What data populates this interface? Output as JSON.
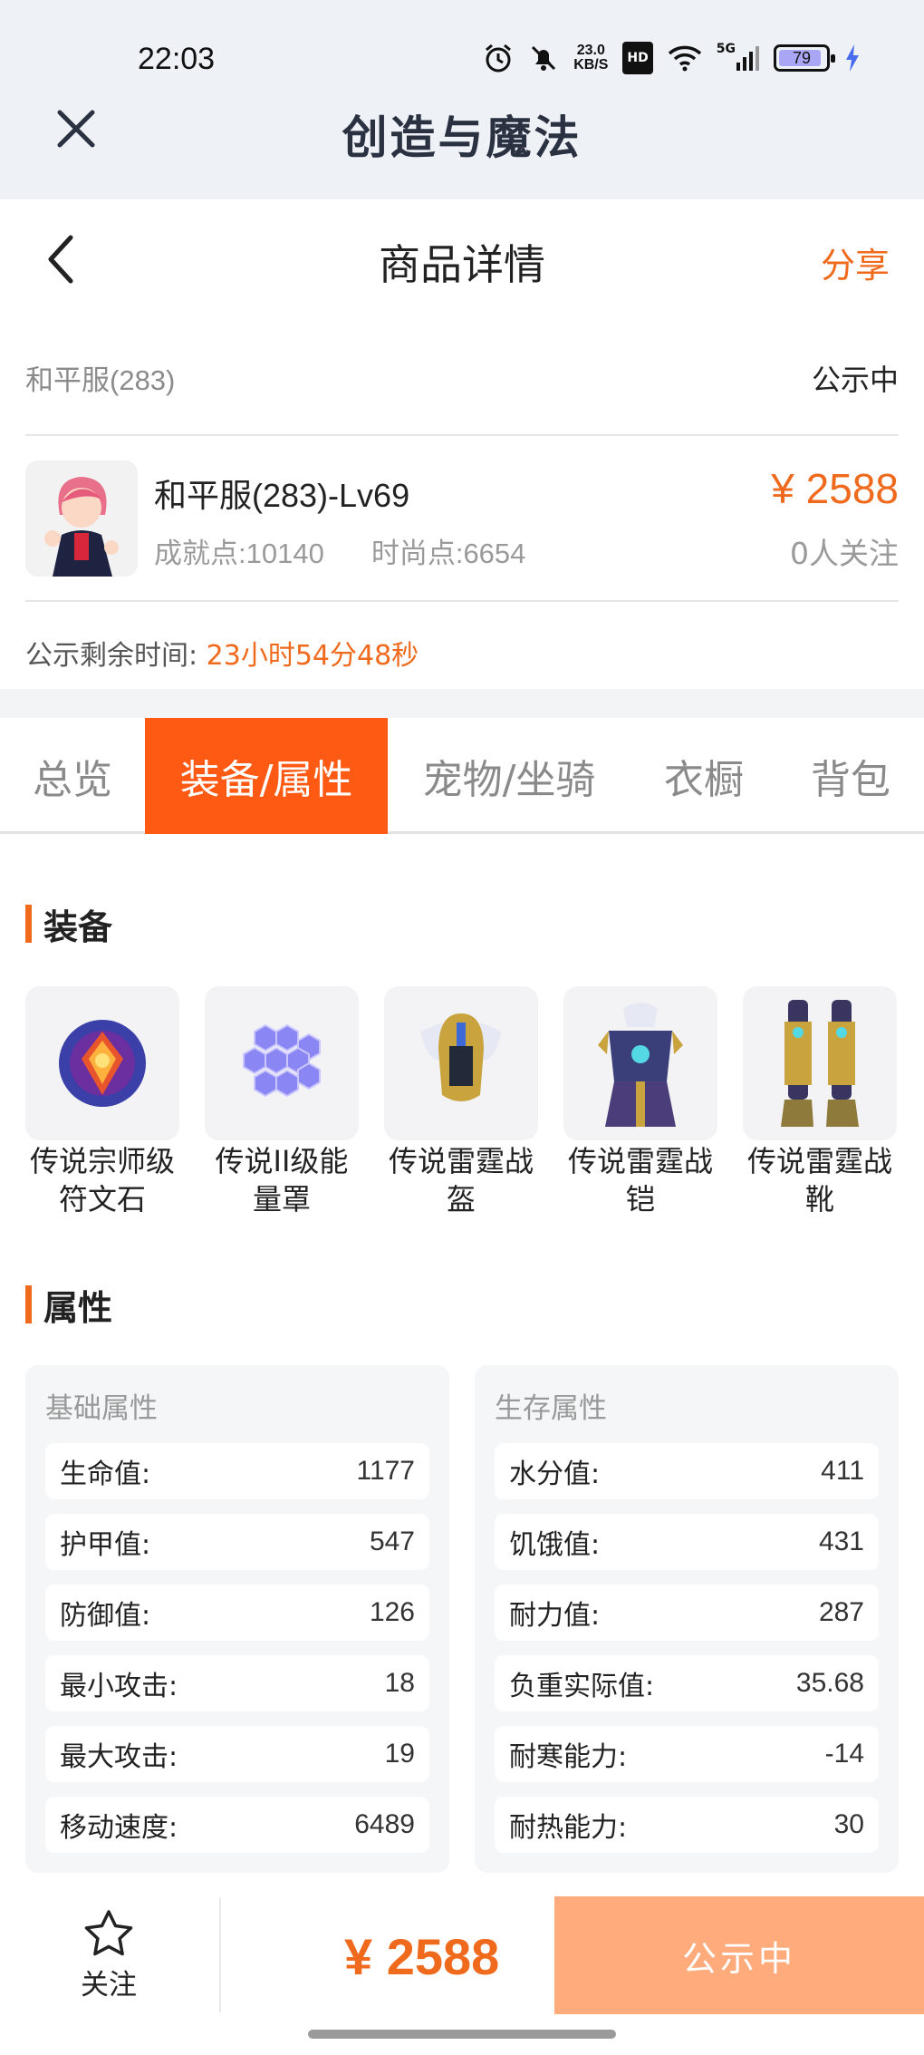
{
  "status_bar": {
    "time": "22:03",
    "net_speed_value": "23.0",
    "net_speed_unit": "KB/S",
    "hd_badge": "HD",
    "signal_label": "5G",
    "battery": "79"
  },
  "app_bar": {
    "title": "创造与魔法"
  },
  "header": {
    "title": "商品详情",
    "share": "分享"
  },
  "listing": {
    "server": "和平服(283)",
    "state": "公示中",
    "name": "和平服(283)-Lv69",
    "achievement": "成就点:10140",
    "fashion": "时尚点:6654",
    "price": "¥ 2588",
    "followers": "0人关注",
    "remain_label": "公示剩余时间:",
    "remain_value": "23小时54分48秒"
  },
  "tabs": [
    "总览",
    "装备/属性",
    "宠物/坐骑",
    "衣橱",
    "背包"
  ],
  "active_tab": 1,
  "equipment": {
    "title": "装备",
    "items": [
      {
        "label_line1": "传说宗师级",
        "label_line2": "符文石",
        "icon": "rune-stone-icon"
      },
      {
        "label_line1": "传说II级能",
        "label_line2": "量罩",
        "icon": "energy-shield-icon"
      },
      {
        "label_line1": "传说雷霆战",
        "label_line2": "盔",
        "icon": "helmet-icon"
      },
      {
        "label_line1": "传说雷霆战",
        "label_line2": "铠",
        "icon": "armor-icon"
      },
      {
        "label_line1": "传说雷霆战",
        "label_line2": "靴",
        "icon": "boots-icon"
      }
    ]
  },
  "attributes": {
    "title": "属性",
    "basic": {
      "title": "基础属性",
      "rows": [
        {
          "label": "生命值:",
          "value": "1177"
        },
        {
          "label": "护甲值:",
          "value": "547"
        },
        {
          "label": "防御值:",
          "value": "126"
        },
        {
          "label": "最小攻击:",
          "value": "18"
        },
        {
          "label": "最大攻击:",
          "value": "19"
        },
        {
          "label": "移动速度:",
          "value": "6489"
        }
      ]
    },
    "survival": {
      "title": "生存属性",
      "rows": [
        {
          "label": "水分值:",
          "value": "411"
        },
        {
          "label": "饥饿值:",
          "value": "431"
        },
        {
          "label": "耐力值:",
          "value": "287"
        },
        {
          "label": "负重实际值:",
          "value": "35.68"
        },
        {
          "label": "耐寒能力:",
          "value": "-14"
        },
        {
          "label": "耐热能力:",
          "value": "30"
        }
      ]
    }
  },
  "bottom_bar": {
    "follow_label": "关注",
    "price": "¥ 2588",
    "action": "公示中"
  },
  "colors": {
    "accent": "#f06a1e",
    "tab_active": "#ff5a14",
    "cta": "#ffab7b"
  }
}
